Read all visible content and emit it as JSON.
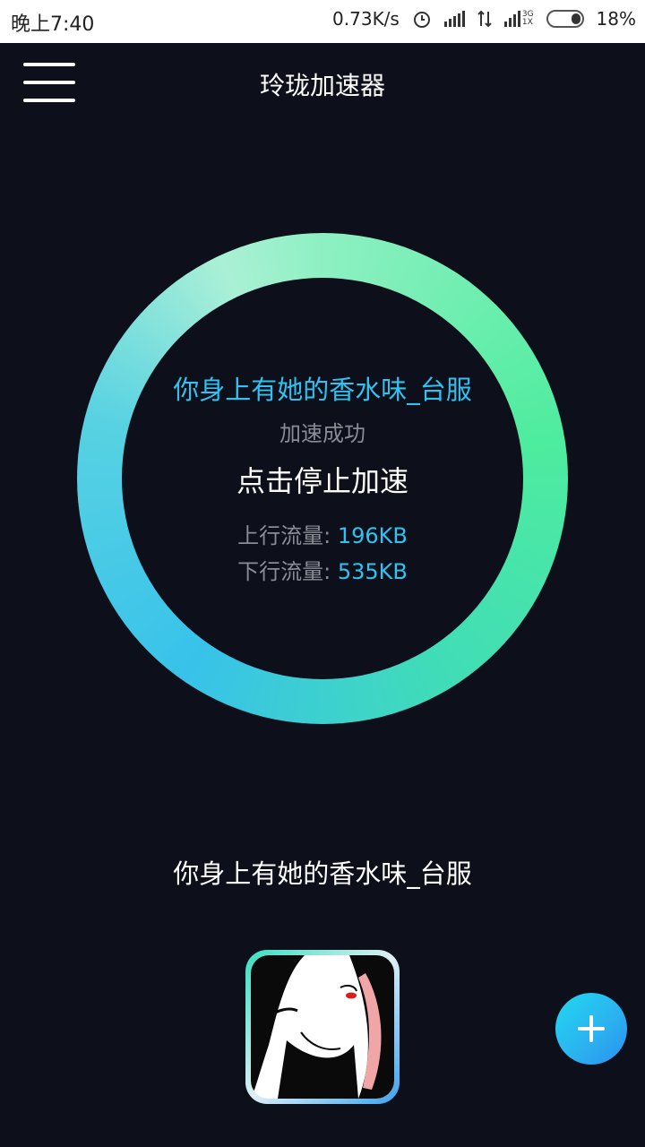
{
  "status_bar": {
    "time": "晚上7:40",
    "net_speed": "0.73K/s",
    "network_type": "3G",
    "sim_label": "1X",
    "battery": "18%"
  },
  "header": {
    "title": "玲珑加速器"
  },
  "accelerator": {
    "song_title": "你身上有她的香水味_台服",
    "status": "加速成功",
    "stop_label": "点击停止加速",
    "upload_label": "上行流量:",
    "upload_value": "196KB",
    "download_label": "下行流量:",
    "download_value": "535KB"
  },
  "current_game": {
    "title": "你身上有她的香水味_台服"
  },
  "colors": {
    "background": "#0d0f1b",
    "accent": "#2ec3f0",
    "ring_green": "#4eec9e",
    "ring_blue": "#38c2ea"
  }
}
